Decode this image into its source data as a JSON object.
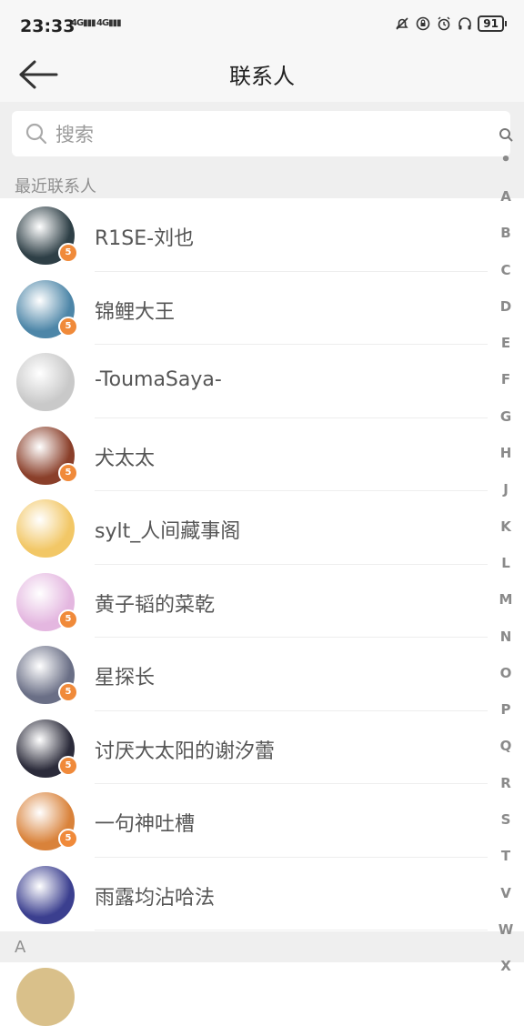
{
  "status_bar": {
    "time": "23:33",
    "signal_1": "4G",
    "signal_2": "4G",
    "battery": "91"
  },
  "header": {
    "title": "联系人"
  },
  "search": {
    "placeholder": "搜索"
  },
  "sections": {
    "recent": "最近联系人",
    "a": "A"
  },
  "contacts": [
    {
      "name": "R1SE-刘也",
      "badge": "5",
      "color": "#2e3f46"
    },
    {
      "name": "锦鲤大王",
      "badge": "5",
      "color": "#4d86a8"
    },
    {
      "name": "-ToumaSaya-",
      "badge": "",
      "color": "#c9c9c9"
    },
    {
      "name": "犬太太",
      "badge": "5",
      "color": "#8a3f2a"
    },
    {
      "name": "sylt_人间藏事阁",
      "badge": "",
      "color": "#f2c766"
    },
    {
      "name": "黄子韬的菜乾",
      "badge": "5",
      "color": "#e4b7e0"
    },
    {
      "name": "星探长",
      "badge": "5",
      "color": "#6a6f86"
    },
    {
      "name": "讨厌大太阳的谢汐蕾",
      "badge": "5",
      "color": "#2b2b3a"
    },
    {
      "name": "一句神吐槽",
      "badge": "5",
      "color": "#d9823a"
    },
    {
      "name": "雨露均沾哈法",
      "badge": "",
      "color": "#3b3f8f"
    }
  ],
  "index_letters": [
    "A",
    "B",
    "C",
    "D",
    "E",
    "F",
    "G",
    "H",
    "J",
    "K",
    "L",
    "M",
    "N",
    "O",
    "P",
    "Q",
    "R",
    "S",
    "T",
    "V",
    "W",
    "X"
  ]
}
